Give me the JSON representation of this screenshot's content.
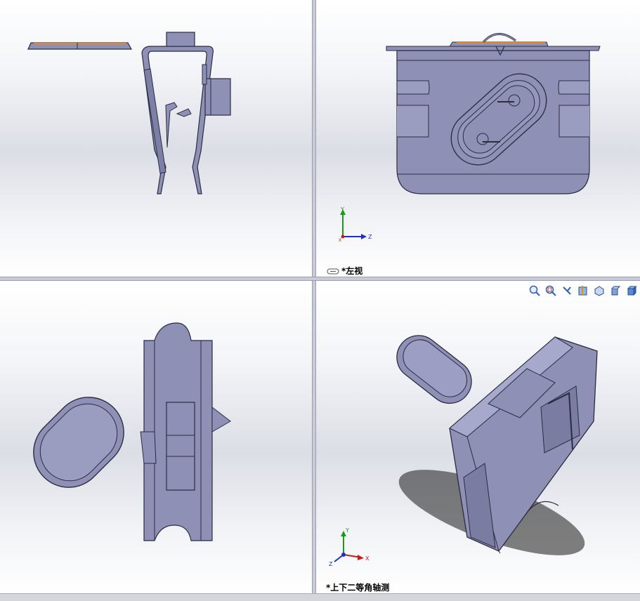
{
  "viewports": {
    "top_right": {
      "label": "*左视"
    },
    "bottom_right": {
      "label": "*上下二等角轴测"
    }
  },
  "triad": {
    "x": "X",
    "y": "Y",
    "z": "Z"
  },
  "heads_up_toolbar": [
    {
      "name": "zoom-to-fit-icon"
    },
    {
      "name": "zoom-to-area-icon"
    },
    {
      "name": "previous-view-icon"
    },
    {
      "name": "section-view-icon"
    },
    {
      "name": "view-orientation-icon"
    },
    {
      "name": "display-style-icon"
    },
    {
      "name": "hide-show-items-icon"
    }
  ],
  "colors": {
    "part": "#8e90b6",
    "edge": "#2a2c40",
    "highlight": "#e08a2a"
  }
}
